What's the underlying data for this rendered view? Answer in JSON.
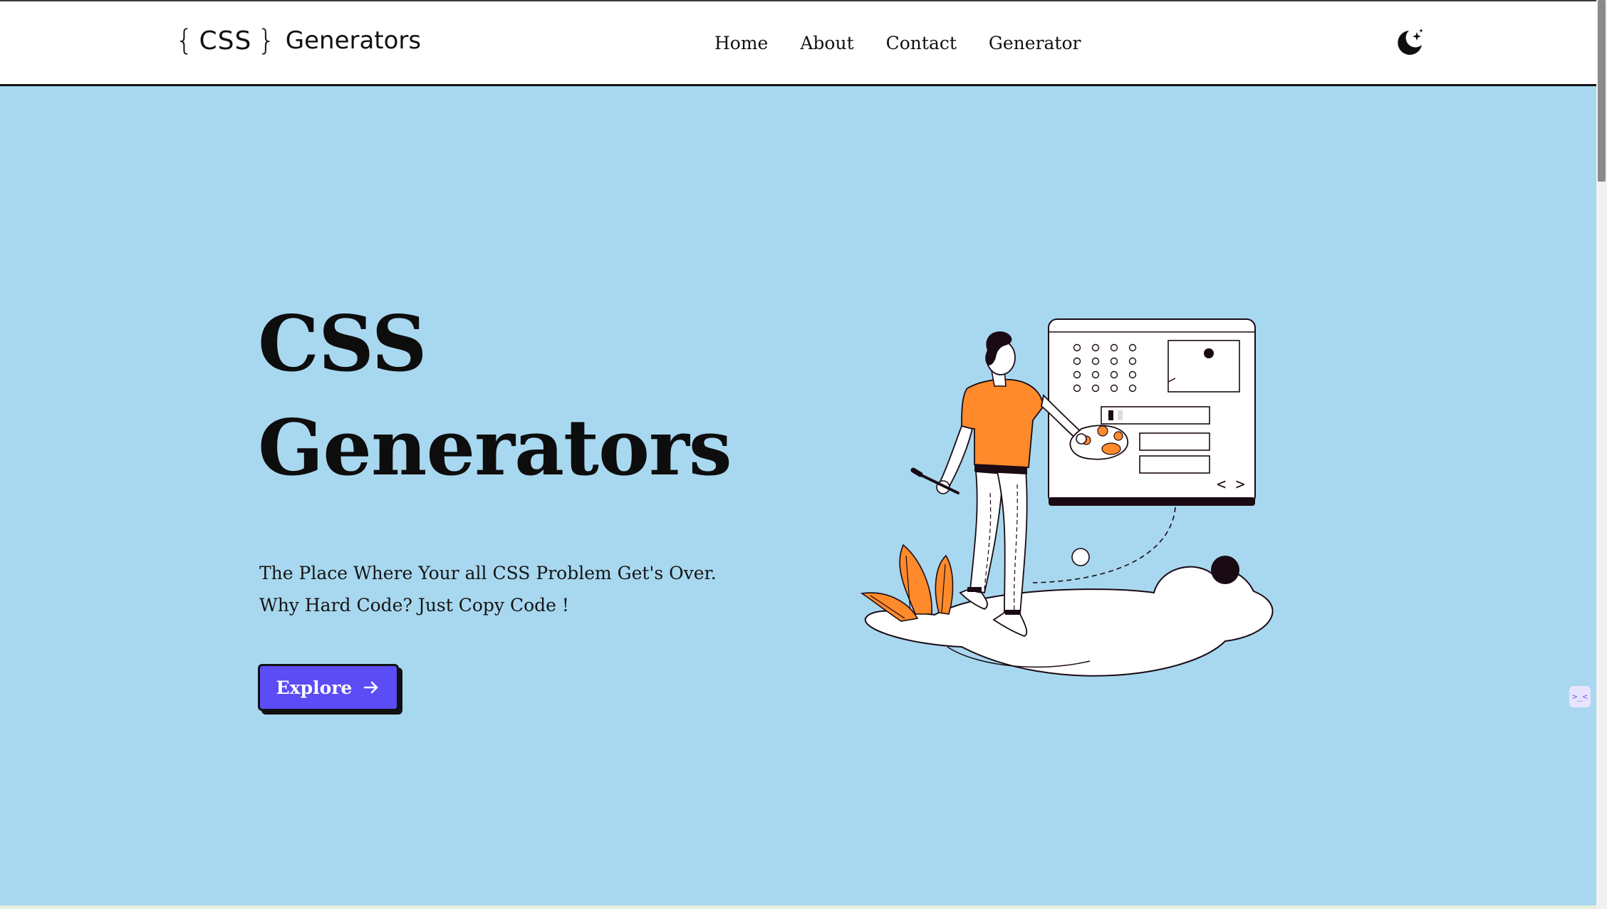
{
  "brand": {
    "brace_open": "{",
    "css": "CSS",
    "brace_close": "}",
    "name": "Generators"
  },
  "nav": {
    "items": [
      {
        "label": "Home"
      },
      {
        "label": "About"
      },
      {
        "label": "Contact"
      },
      {
        "label": "Generator"
      }
    ],
    "theme_toggle_icon": "moon-stars-icon"
  },
  "hero": {
    "title_line1": "CSS",
    "title_line2": "Generators",
    "tagline_line1": "The Place Where Your all CSS Problem Get's Over.",
    "tagline_line2": "Why Hard Code? Just Copy Code !",
    "cta_label": "Explore",
    "cta_icon": "arrow-right-icon"
  },
  "illustration": {
    "code_symbol": "< >"
  },
  "side_widget": {
    "icon": "code-widget-icon",
    "text": ">_<"
  },
  "colors": {
    "background": "#a8d8ef",
    "accent_button": "#5b4cf5",
    "illustration_orange": "#ff8a2b",
    "dark": "#1a0a14"
  }
}
